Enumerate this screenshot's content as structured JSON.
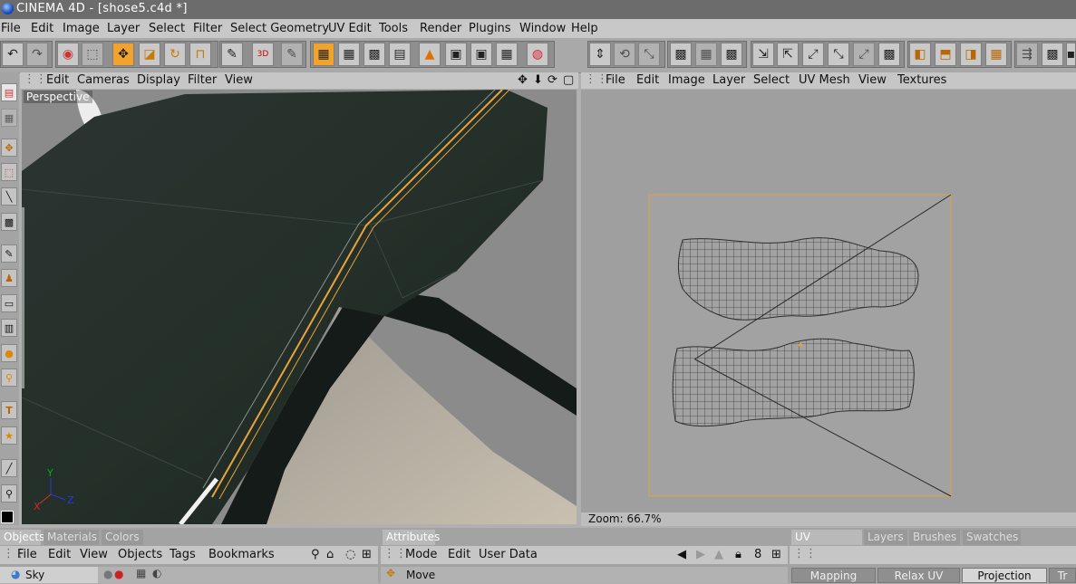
{
  "window": {
    "title": "CINEMA 4D - [shose5.c4d *]"
  },
  "menubar": [
    "File",
    "Edit",
    "Image",
    "Layer",
    "Select",
    "Filter",
    "Select Geometry",
    "UV Edit",
    "Tools",
    "Render",
    "Plugins",
    "Window",
    "Help"
  ],
  "viewport": {
    "menu": [
      "Edit",
      "Cameras",
      "Display",
      "Filter",
      "View"
    ],
    "label": "Perspective",
    "axes": {
      "x": "X",
      "y": "Y",
      "z": "Z"
    }
  },
  "uv_panel": {
    "menu": [
      "File",
      "Edit",
      "Image",
      "Layer",
      "Select",
      "UV Mesh",
      "View",
      "Textures"
    ],
    "zoom_text": "Zoom: 66.7%"
  },
  "bottom_left": {
    "tabs": [
      "Objects",
      "Materials",
      "Colors"
    ],
    "menu": [
      "File",
      "Edit",
      "View",
      "Objects",
      "Tags",
      "Bookmarks"
    ],
    "first_object": "Sky"
  },
  "bottom_mid": {
    "tabs": [
      "Attributes"
    ],
    "menu": [
      "Mode",
      "Edit",
      "User Data"
    ],
    "first_row": "Move"
  },
  "bottom_right": {
    "tabs": [
      "UV Mapping",
      "Layers",
      "Brushes",
      "Swatches"
    ],
    "subtabs": [
      "Mapping",
      "Relax UV",
      "Projection",
      "Tr"
    ]
  },
  "colors": {
    "accent": "#f2a32e",
    "selection_line": "#e8a33a",
    "uv_border": "#e2a040"
  }
}
